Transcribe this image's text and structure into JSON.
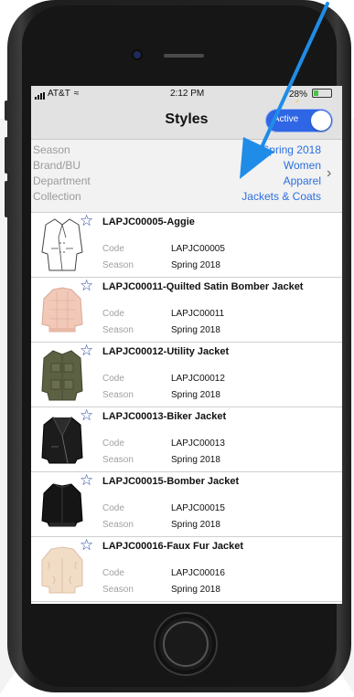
{
  "status_bar": {
    "carrier": "AT&T",
    "time": "2:12 PM",
    "battery": "28%",
    "battery_level": 0.28
  },
  "nav": {
    "title": "Styles",
    "toggle_label": "Active",
    "toggle_on": true
  },
  "filters": [
    {
      "label": "Season",
      "value": "Spring 2018"
    },
    {
      "label": "Brand/BU",
      "value": "Women"
    },
    {
      "label": "Department",
      "value": "Apparel"
    },
    {
      "label": "Collection",
      "value": "Jackets & Coats"
    }
  ],
  "columns": {
    "code": "Code",
    "season": "Season"
  },
  "styles": [
    {
      "title": "LAPJC00005-Aggie",
      "code": "LAPJC00005",
      "season": "Spring 2018",
      "image": "sketch-coat"
    },
    {
      "title": "LAPJC00011-Quilted Satin Bomber Jacket",
      "code": "LAPJC00011",
      "season": "Spring 2018",
      "image": "pink-bomber"
    },
    {
      "title": "LAPJC00012-Utility Jacket",
      "code": "LAPJC00012",
      "season": "Spring 2018",
      "image": "olive-utility"
    },
    {
      "title": "LAPJC00013-Biker Jacket",
      "code": "LAPJC00013",
      "season": "Spring 2018",
      "image": "black-biker"
    },
    {
      "title": "LAPJC00015-Bomber Jacket",
      "code": "LAPJC00015",
      "season": "Spring 2018",
      "image": "black-bomber"
    },
    {
      "title": "LAPJC00016-Faux Fur Jacket",
      "code": "LAPJC00016",
      "season": "Spring 2018",
      "image": "cream-fur"
    }
  ],
  "colors": {
    "accent": "#2a6fe0",
    "toggle": "#2e66e5",
    "arrow": "#1f8ce8",
    "star": "#2b4aa8",
    "bar_bg": "#e2e2e2"
  }
}
